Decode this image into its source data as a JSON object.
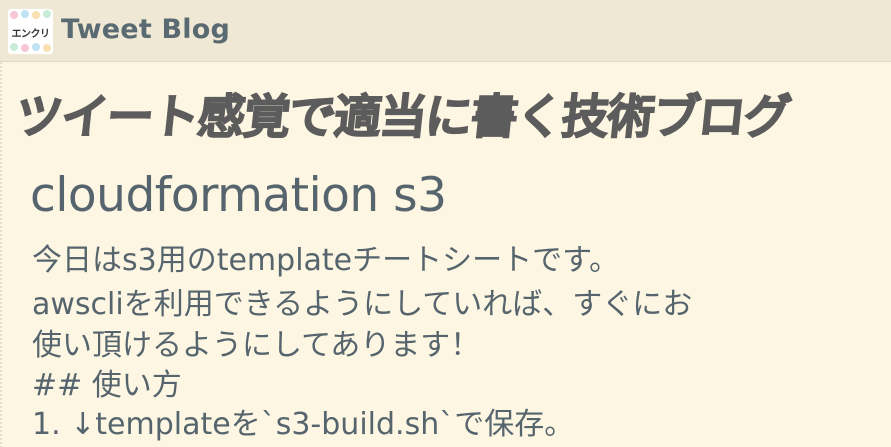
{
  "header": {
    "logo_text": "エンクリ",
    "brand": "Tweet Blog"
  },
  "banner": {
    "text": "ツイート感覚で適当に書く技術ブログ"
  },
  "post": {
    "title": "cloudformation s3",
    "lines": [
      "今日はs3用のtemplateチートシートです。",
      "awscliを利用できるようにしていれば、すぐにお",
      "使い頂けるようにしてあります！",
      "## 使い方",
      "1. ↓templateを`s3-build.sh`で保存。"
    ]
  },
  "colors": {
    "background": "#fdf6e3",
    "header_bg": "#efe8d4",
    "text": "#56656d",
    "banner": "#5c5c5c"
  }
}
